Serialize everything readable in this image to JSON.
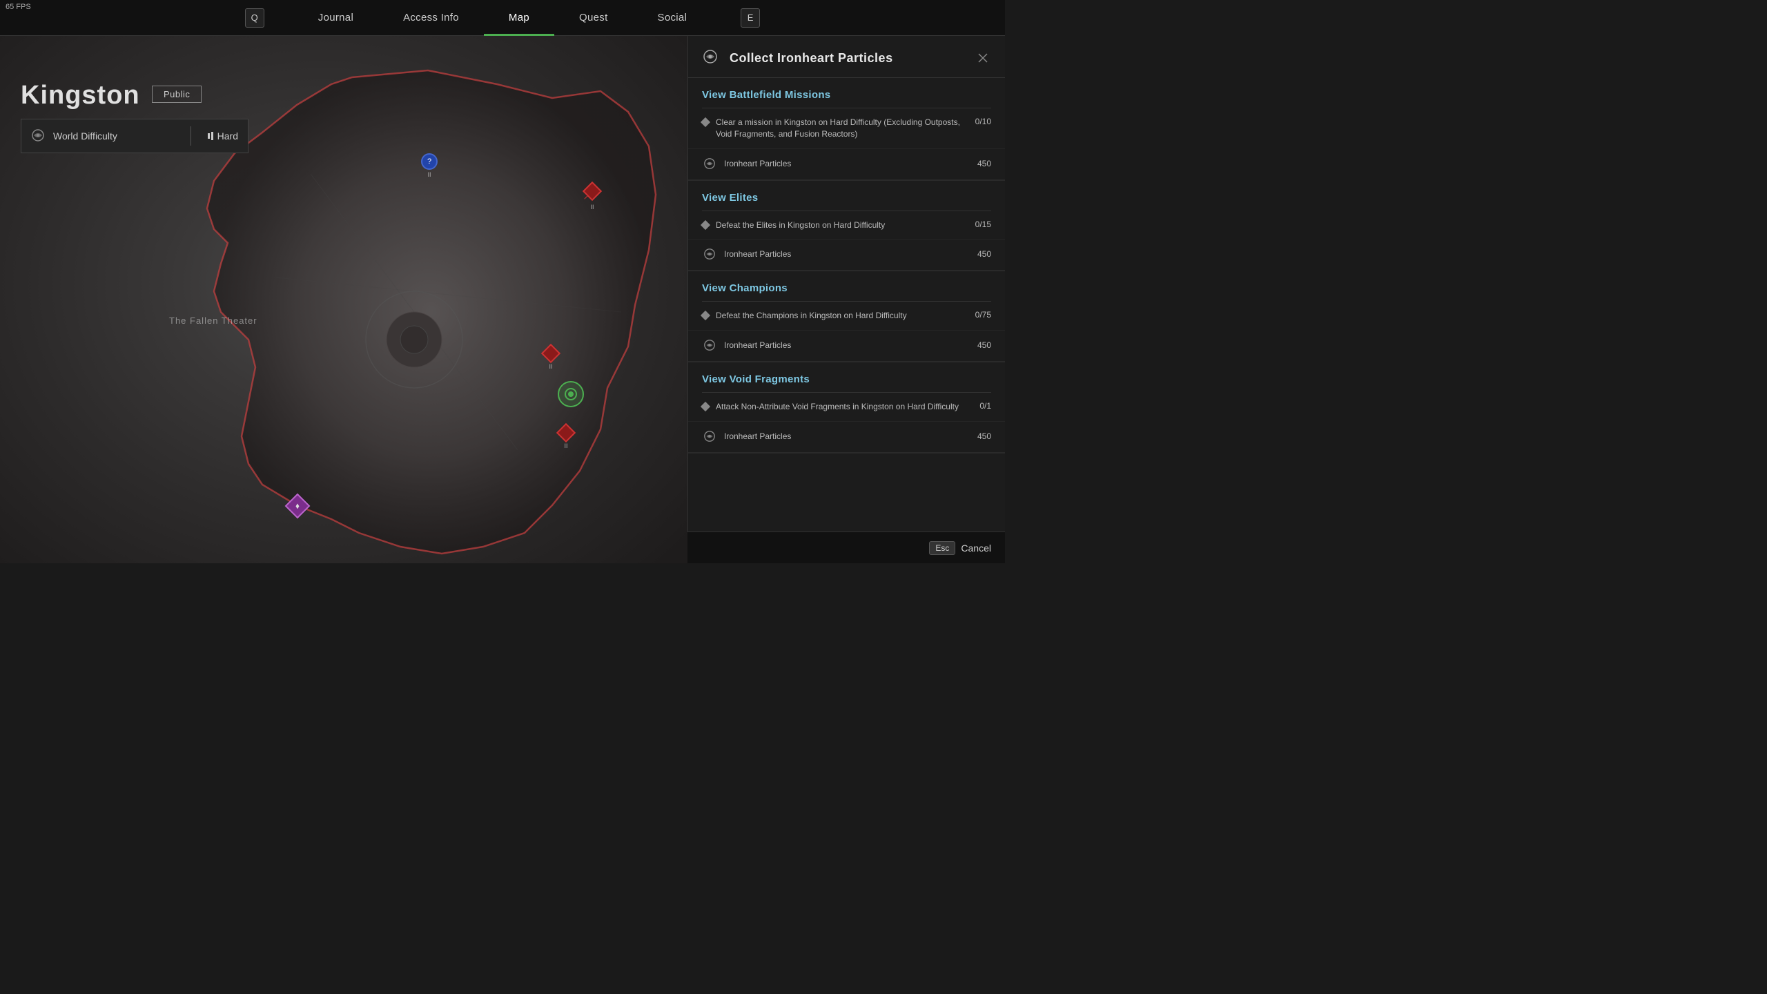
{
  "fps": "65 FPS",
  "nav": {
    "tabs": [
      {
        "id": "q-key",
        "key": "Q",
        "label": null,
        "isKey": true
      },
      {
        "id": "journal",
        "label": "Journal"
      },
      {
        "id": "access-info",
        "label": "Access Info"
      },
      {
        "id": "map",
        "label": "Map",
        "active": true
      },
      {
        "id": "quest",
        "label": "Quest"
      },
      {
        "id": "social",
        "label": "Social"
      },
      {
        "id": "e-key",
        "key": "E",
        "label": null,
        "isKey": true
      }
    ]
  },
  "map": {
    "location": "Kingston",
    "badge": "Public",
    "worldDifficulty": {
      "label": "World Difficulty",
      "value": "Hard"
    },
    "theaterLabel": "The Fallen Theater"
  },
  "panel": {
    "title": "Collect Ironheart Particles",
    "sections": [
      {
        "id": "battlefield",
        "title": "View Battlefield Missions",
        "missions": [
          {
            "text": "Clear a mission in Kingston on Hard Difficulty (Excluding Outposts, Void Fragments, and Fusion Reactors)",
            "progress": "0/10"
          }
        ],
        "rewards": [
          {
            "name": "Ironheart Particles",
            "amount": "450"
          }
        ]
      },
      {
        "id": "elites",
        "title": "View Elites",
        "missions": [
          {
            "text": "Defeat the Elites in Kingston on Hard Difficulty",
            "progress": "0/15"
          }
        ],
        "rewards": [
          {
            "name": "Ironheart Particles",
            "amount": "450"
          }
        ]
      },
      {
        "id": "champions",
        "title": "View Champions",
        "missions": [
          {
            "text": "Defeat the Champions in Kingston on Hard Difficulty",
            "progress": "0/75"
          }
        ],
        "rewards": [
          {
            "name": "Ironheart Particles",
            "amount": "450"
          }
        ]
      },
      {
        "id": "void-fragments",
        "title": "View Void Fragments",
        "missions": [
          {
            "text": "Attack Non-Attribute Void Fragments in Kingston on Hard Difficulty",
            "progress": "0/1"
          }
        ],
        "rewards": [
          {
            "name": "Ironheart Particles",
            "amount": "450"
          }
        ]
      }
    ]
  },
  "bottomBar": {
    "escKey": "Esc",
    "cancelLabel": "Cancel"
  }
}
